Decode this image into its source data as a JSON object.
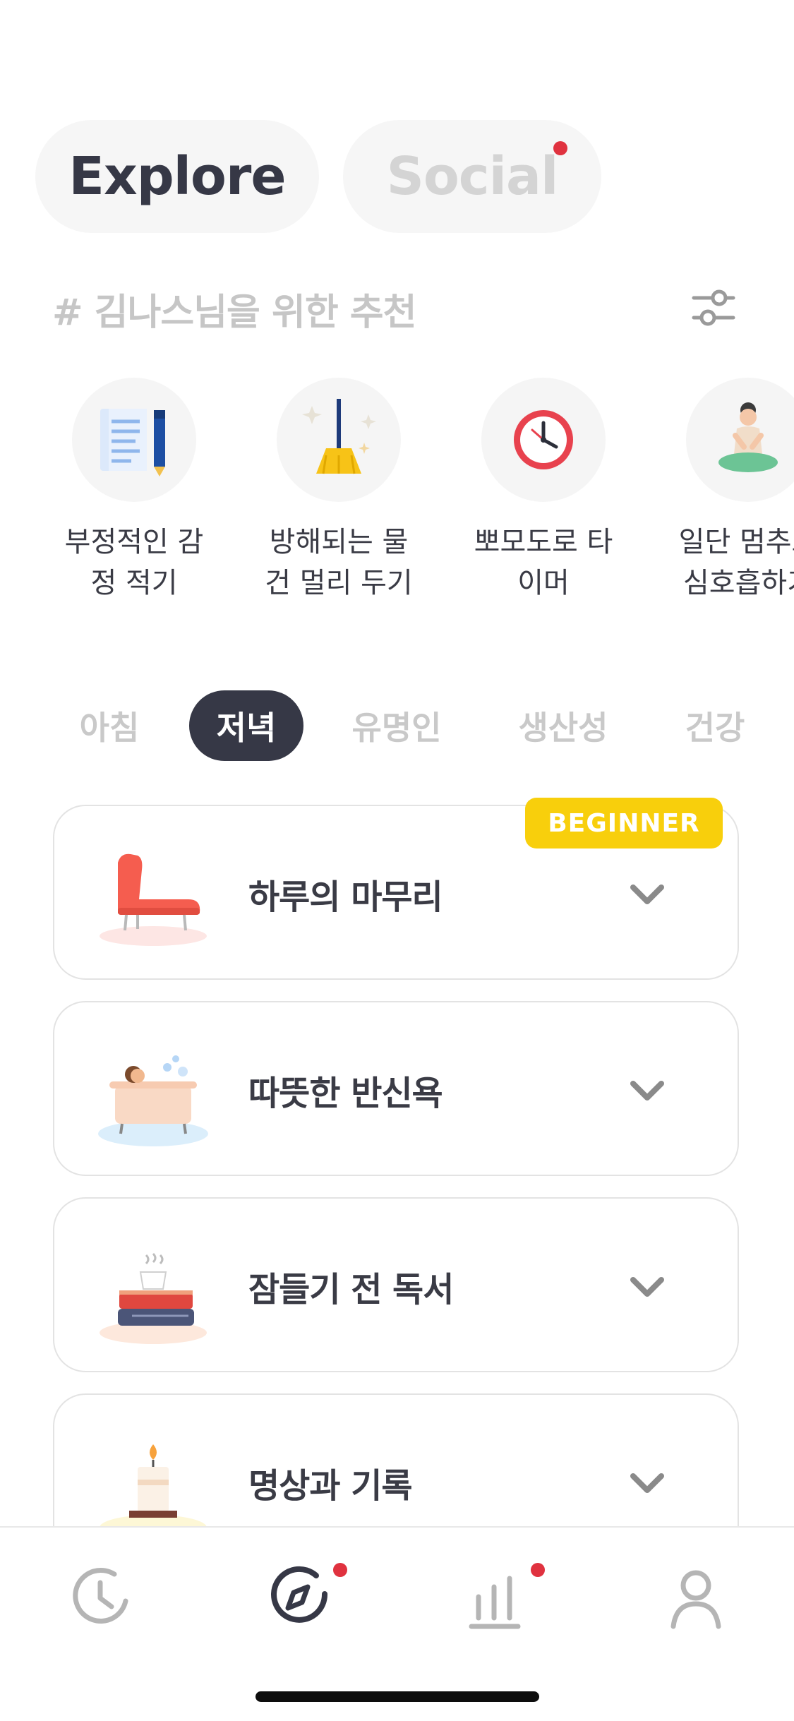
{
  "top_tabs": {
    "explore": "Explore",
    "social": "Social",
    "social_has_notification": true
  },
  "recommendations": {
    "heading": "# 김나스님을 위한 추천",
    "filter_icon": "sliders-icon",
    "items": [
      {
        "label": "부정적인 감\n정 적기",
        "icon": "notes-pencil-icon"
      },
      {
        "label": "방해되는 물\n건 멀리 두기",
        "icon": "broom-icon"
      },
      {
        "label": "뽀모도로 타\n이머",
        "icon": "clock-icon"
      },
      {
        "label": "일단 멈추고\n심호흡하기",
        "icon": "meditation-icon"
      }
    ]
  },
  "categories": {
    "items": [
      "아침",
      "저녁",
      "유명인",
      "생산성",
      "건강"
    ],
    "selected": "저녁"
  },
  "routines": [
    {
      "title": "하루의 마무리",
      "icon": "armchair-icon",
      "badge": "BEGINNER"
    },
    {
      "title": "따뜻한 반신욕",
      "icon": "bathtub-icon"
    },
    {
      "title": "잠들기 전 독서",
      "icon": "books-tea-icon"
    },
    {
      "title": "명상과 기록",
      "icon": "candle-icon"
    }
  ],
  "bottom_nav": [
    {
      "name": "history",
      "icon": "clock-icon",
      "active": false,
      "notification": false
    },
    {
      "name": "explore",
      "icon": "compass-icon",
      "active": true,
      "notification": true
    },
    {
      "name": "stats",
      "icon": "bar-chart-icon",
      "active": false,
      "notification": true
    },
    {
      "name": "profile",
      "icon": "user-icon",
      "active": false,
      "notification": false
    }
  ],
  "colors": {
    "accent_dark": "#363846",
    "badge_yellow": "#f8cf0c",
    "notification_red": "#e0323f",
    "inactive_gray": "#c9c9c9"
  }
}
